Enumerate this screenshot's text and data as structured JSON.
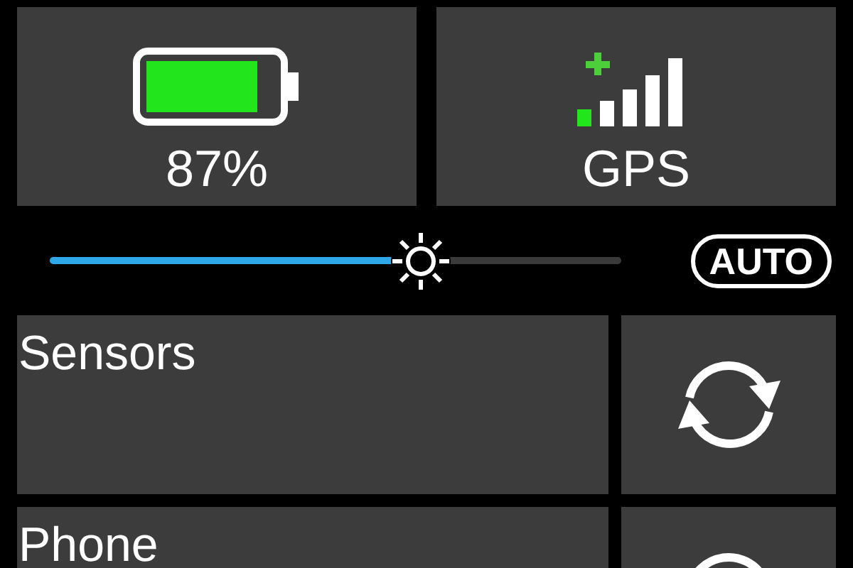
{
  "status_tiles": [
    {
      "kind": "battery",
      "label": "87%"
    },
    {
      "kind": "gps",
      "label": "GPS"
    }
  ],
  "brightness": {
    "level": 0.65,
    "auto_label": "AUTO"
  },
  "rows": [
    {
      "label": "Sensors"
    },
    {
      "label": "Phone"
    }
  ]
}
